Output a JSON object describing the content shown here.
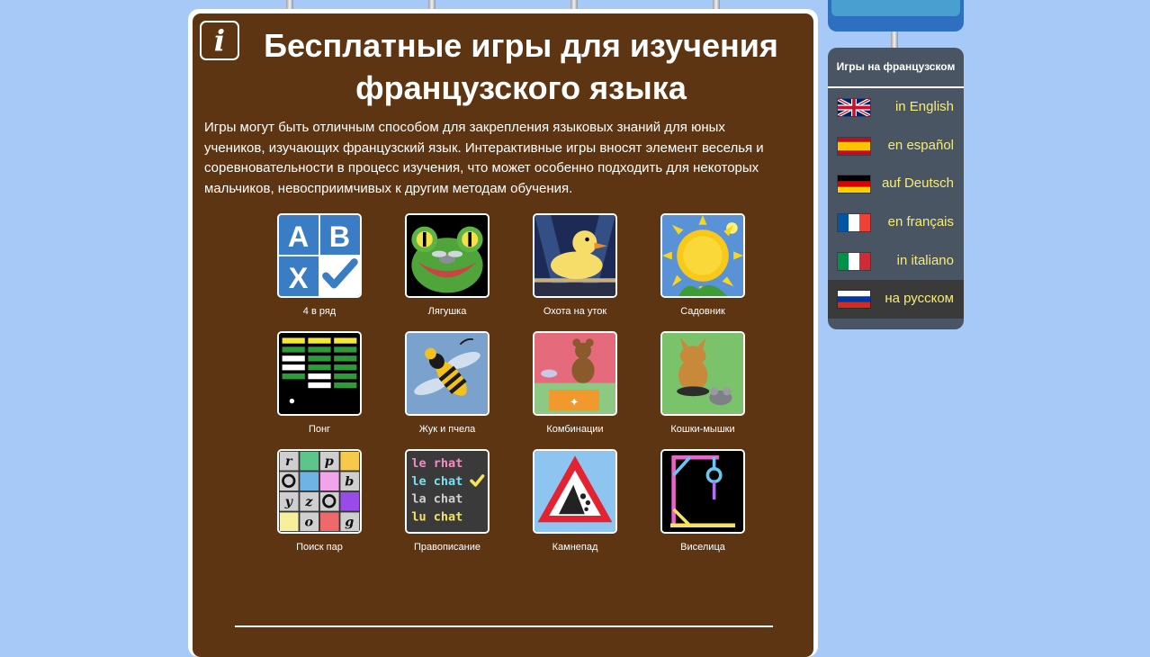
{
  "main": {
    "info_icon": "i",
    "title": "Бесплатные игры для изучения французского языка",
    "intro": "Игры могут быть отличным способом для закрепления языковых знаний для юных учеников, изучающих французский язык. Интерактивные игры вносят элемент веселья и соревновательности в процесс изучения, что может особенно подходить для некоторых мальчиков, невосприимчивых к другим методам обучения.",
    "games": [
      {
        "label": "4 в ряд",
        "icon": "abc-quiz-icon"
      },
      {
        "label": "Лягушка",
        "icon": "frog-icon"
      },
      {
        "label": "Охота на уток",
        "icon": "duck-icon"
      },
      {
        "label": "Садовник",
        "icon": "sunflower-icon"
      },
      {
        "label": "Понг",
        "icon": "pong-icon"
      },
      {
        "label": "Жук и пчела",
        "icon": "wasp-icon"
      },
      {
        "label": "Комбинации",
        "icon": "teddy-bear-icon"
      },
      {
        "label": "Кошки-мышки",
        "icon": "cat-mouse-icon"
      },
      {
        "label": "Поиск пар",
        "icon": "pairs-grid-icon"
      },
      {
        "label": "Правописание",
        "icon": "spelling-icon"
      },
      {
        "label": "Камнепад",
        "icon": "rockfall-sign-icon"
      },
      {
        "label": "Виселица",
        "icon": "hangman-icon"
      }
    ],
    "spelling_tile_words": [
      "le rhat",
      "le chat",
      "la chat",
      "lu chat"
    ],
    "abc_tile_letters": [
      "A",
      "B",
      "X"
    ],
    "pairs_tile_letters": [
      "r",
      "p",
      "b",
      "y",
      "z",
      "o",
      "g"
    ]
  },
  "sidebar": {
    "heading": "Игры на французском",
    "languages": [
      {
        "label": "in English",
        "flag": "uk-flag-icon"
      },
      {
        "label": "en español",
        "flag": "spain-flag-icon"
      },
      {
        "label": "auf Deutsch",
        "flag": "germany-flag-icon"
      },
      {
        "label": "en français",
        "flag": "france-flag-icon"
      },
      {
        "label": "in italiano",
        "flag": "italy-flag-icon"
      },
      {
        "label": "на русском",
        "flag": "russia-flag-icon",
        "active": true
      }
    ]
  },
  "colors": {
    "page_background": "#a7c9f7",
    "board_background": "#5e3512",
    "panel_background": "#4a5563",
    "language_link": "#f6ec72"
  }
}
